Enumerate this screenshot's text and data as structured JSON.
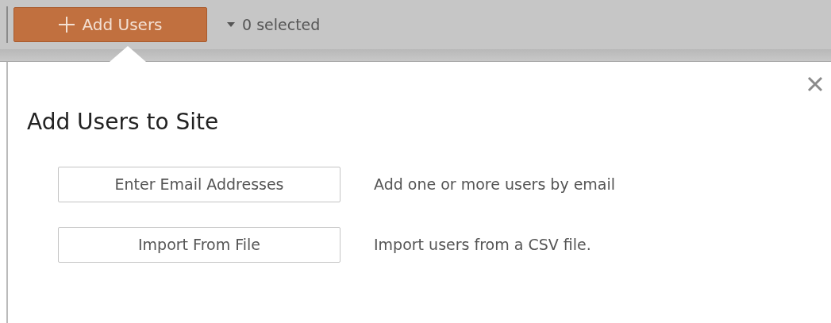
{
  "toolbar": {
    "add_button": "Add Users",
    "selection": "0 selected"
  },
  "dialog": {
    "title": "Add Users to Site",
    "options": [
      {
        "button": "Enter Email Addresses",
        "description": "Add one or more users by email"
      },
      {
        "button": "Import From File",
        "description": "Import users from a CSV file."
      }
    ]
  }
}
